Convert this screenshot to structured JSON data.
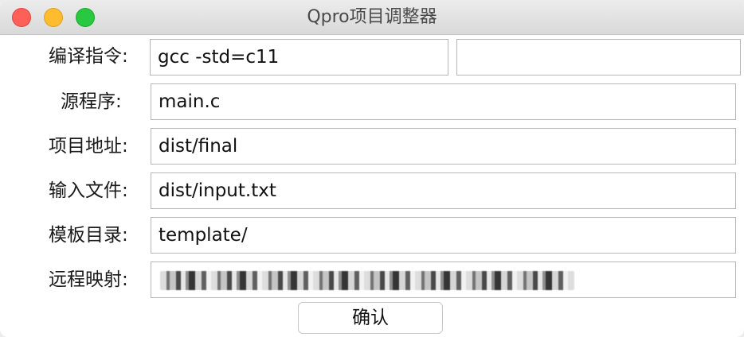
{
  "window": {
    "title": "Qpro项目调整器"
  },
  "form": {
    "compile": {
      "label": "编译指令:",
      "value": "gcc -std=c11",
      "extra_value": ""
    },
    "source": {
      "label": "源程序:",
      "value": "main.c"
    },
    "project_path": {
      "label": "项目地址:",
      "value": "dist/final"
    },
    "input_file": {
      "label": "输入文件:",
      "value": "dist/input.txt"
    },
    "template_dir": {
      "label": "模板目录:",
      "value": "template/"
    },
    "remote_map": {
      "label": "远程映射:",
      "value": ""
    }
  },
  "actions": {
    "confirm_label": "确认"
  },
  "colors": {
    "close": "#fe5f57",
    "minimize": "#febc2e",
    "maximize": "#28c840"
  }
}
